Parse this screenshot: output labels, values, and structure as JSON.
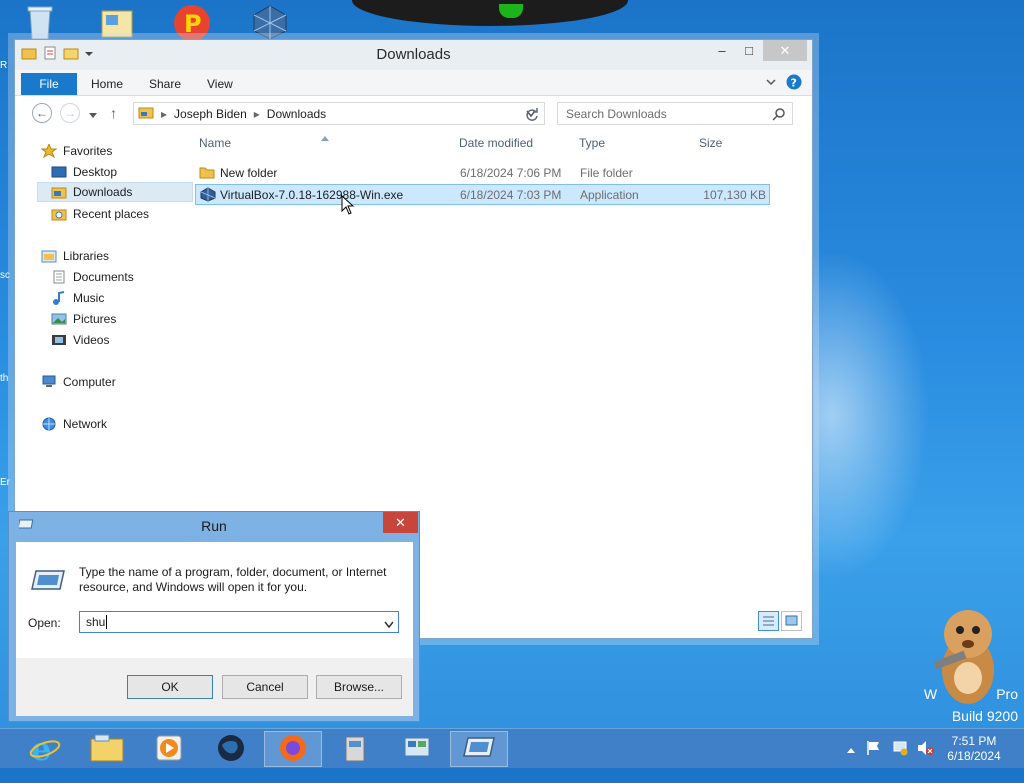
{
  "explorer": {
    "title": "Downloads",
    "ribbon_tabs": [
      "File",
      "Home",
      "Share",
      "View"
    ],
    "address": [
      "Joseph Biden",
      "Downloads"
    ],
    "search_placeholder": "Search Downloads",
    "nav": {
      "favorites": "Favorites",
      "desktop": "Desktop",
      "downloads": "Downloads",
      "recent": "Recent places",
      "libraries": "Libraries",
      "documents": "Documents",
      "music": "Music",
      "pictures": "Pictures",
      "videos": "Videos",
      "computer": "Computer",
      "network": "Network"
    },
    "columns": {
      "name": "Name",
      "date": "Date modified",
      "type": "Type",
      "size": "Size"
    },
    "files": [
      {
        "name": "New folder",
        "date": "6/18/2024 7:06 PM",
        "type": "File folder",
        "size": ""
      },
      {
        "name": "VirtualBox-7.0.18-162988-Win.exe",
        "date": "6/18/2024 7:03 PM",
        "type": "Application",
        "size": "107,130 KB"
      }
    ]
  },
  "run": {
    "title": "Run",
    "description": "Type the name of a program, folder, document, or Internet resource, and Windows will open it for you.",
    "open_label": "Open:",
    "input_value": "shu",
    "ok": "OK",
    "cancel": "Cancel",
    "browse": "Browse..."
  },
  "watermark": {
    "edition": "Pro",
    "build": "Build 9200"
  },
  "clock": {
    "time": "7:51 PM",
    "date": "6/18/2024"
  },
  "colors": {
    "accent": "#1979ca",
    "selection": "#cce8ff",
    "taskbar": "#3f80c8",
    "close": "#c7453a"
  }
}
